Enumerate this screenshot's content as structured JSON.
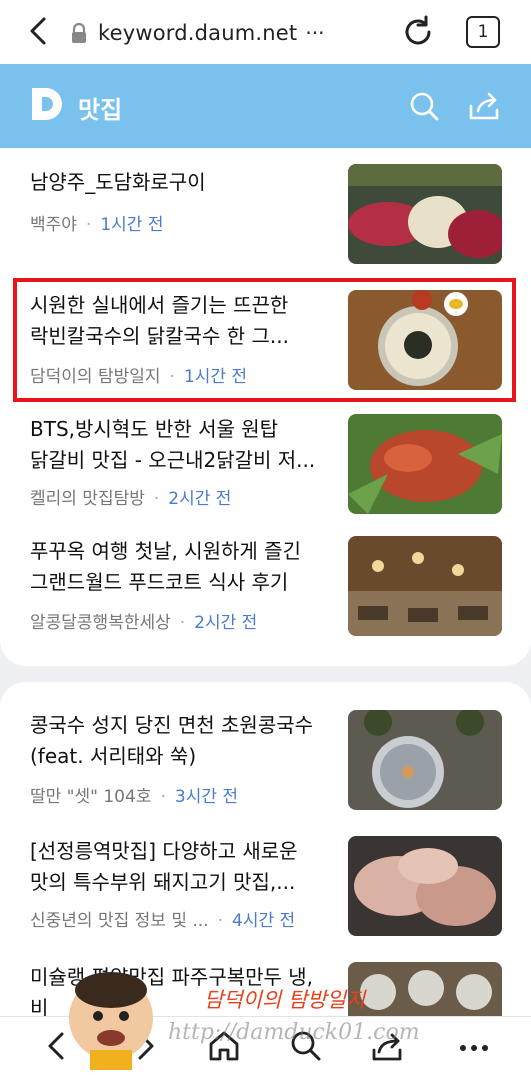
{
  "browser": {
    "url": "keyword.daum.net",
    "url_more": "···",
    "tab_count": "1"
  },
  "header": {
    "logo_letter": "D",
    "title": "맛집"
  },
  "colors": {
    "header_bg": "#7ac1ee",
    "time_text": "#4a7bd1",
    "highlight": "#e8151b"
  },
  "feed": [
    {
      "title": "남양주_도담화로구이",
      "source": "백주야",
      "time": "1시간 전"
    },
    {
      "title": "시원한 실내에서 즐기는 뜨끈한 락빈칼국수의 닭칼국수 한 그...",
      "source": "담덕이의 탐방일지",
      "time": "1시간 전"
    },
    {
      "title": "BTS,방시혁도 반한 서울 원탑 닭갈비 맛집 - 오근내2닭갈비 저...",
      "source": "켈리의 맛집탐방",
      "time": "2시간 전"
    },
    {
      "title": "푸꾸옥 여행 첫날, 시원하게 즐긴 그랜드월드 푸드코트 식사 후기",
      "source": "알콩달콩행복한세상",
      "time": "2시간 전"
    },
    {
      "title": "콩국수 성지 당진 면천 초원콩국수(feat. 서리태와 쑥)",
      "source": "딸만 \"셋\" 104호",
      "time": "3시간 전"
    },
    {
      "title": "[선정릉역맛집] 다양하고 새로운 맛의 특수부위 돼지고기 맛집,...",
      "source": "신중년의 맛집 정보 및 ...",
      "time": "4시간 전"
    },
    {
      "title": "미슐랭 평양맛집 파주구복만두 냉,비",
      "source": "",
      "time": ""
    }
  ],
  "watermark": {
    "name": "담덕이의 탐방일지",
    "url": "http://damduck01.com"
  },
  "icons": [
    "back-icon",
    "lock-icon",
    "reload-icon",
    "search-icon",
    "share-icon",
    "home-icon",
    "tabs-icon",
    "more-icon"
  ]
}
